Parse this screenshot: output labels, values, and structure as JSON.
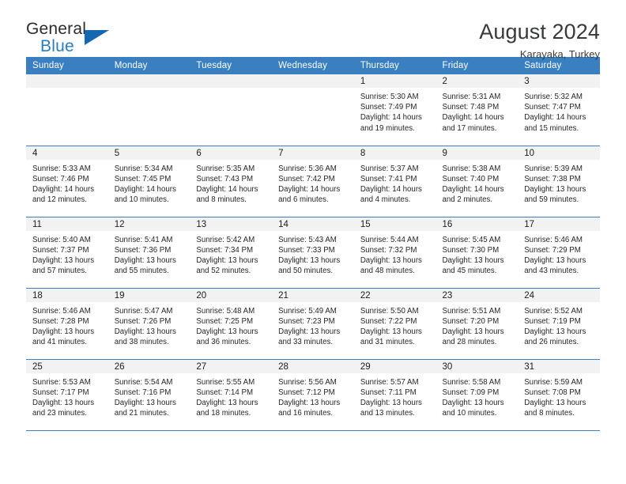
{
  "brand": {
    "name_part1": "General",
    "name_part2": "Blue",
    "triangle_icon": "triangle-icon",
    "color_dark": "#2b2b2b",
    "color_blue": "#2b7cc0"
  },
  "header": {
    "title": "August 2024",
    "subtitle": "Karayaka, Turkey",
    "accent_color": "#3a7fbf",
    "band_color": "#f2f2f2"
  },
  "weekday_headers": [
    "Sunday",
    "Monday",
    "Tuesday",
    "Wednesday",
    "Thursday",
    "Friday",
    "Saturday"
  ],
  "labels": {
    "sunrise": "Sunrise:",
    "sunset": "Sunset:",
    "daylight": "Daylight:"
  },
  "weeks": [
    [
      {
        "day": "",
        "empty": true
      },
      {
        "day": "",
        "empty": true
      },
      {
        "day": "",
        "empty": true
      },
      {
        "day": "",
        "empty": true
      },
      {
        "day": "1",
        "sunrise": "Sunrise: 5:30 AM",
        "sunset": "Sunset: 7:49 PM",
        "daylight_l1": "Daylight: 14 hours",
        "daylight_l2": "and 19 minutes."
      },
      {
        "day": "2",
        "sunrise": "Sunrise: 5:31 AM",
        "sunset": "Sunset: 7:48 PM",
        "daylight_l1": "Daylight: 14 hours",
        "daylight_l2": "and 17 minutes."
      },
      {
        "day": "3",
        "sunrise": "Sunrise: 5:32 AM",
        "sunset": "Sunset: 7:47 PM",
        "daylight_l1": "Daylight: 14 hours",
        "daylight_l2": "and 15 minutes."
      }
    ],
    [
      {
        "day": "4",
        "sunrise": "Sunrise: 5:33 AM",
        "sunset": "Sunset: 7:46 PM",
        "daylight_l1": "Daylight: 14 hours",
        "daylight_l2": "and 12 minutes."
      },
      {
        "day": "5",
        "sunrise": "Sunrise: 5:34 AM",
        "sunset": "Sunset: 7:45 PM",
        "daylight_l1": "Daylight: 14 hours",
        "daylight_l2": "and 10 minutes."
      },
      {
        "day": "6",
        "sunrise": "Sunrise: 5:35 AM",
        "sunset": "Sunset: 7:43 PM",
        "daylight_l1": "Daylight: 14 hours",
        "daylight_l2": "and 8 minutes."
      },
      {
        "day": "7",
        "sunrise": "Sunrise: 5:36 AM",
        "sunset": "Sunset: 7:42 PM",
        "daylight_l1": "Daylight: 14 hours",
        "daylight_l2": "and 6 minutes."
      },
      {
        "day": "8",
        "sunrise": "Sunrise: 5:37 AM",
        "sunset": "Sunset: 7:41 PM",
        "daylight_l1": "Daylight: 14 hours",
        "daylight_l2": "and 4 minutes."
      },
      {
        "day": "9",
        "sunrise": "Sunrise: 5:38 AM",
        "sunset": "Sunset: 7:40 PM",
        "daylight_l1": "Daylight: 14 hours",
        "daylight_l2": "and 2 minutes."
      },
      {
        "day": "10",
        "sunrise": "Sunrise: 5:39 AM",
        "sunset": "Sunset: 7:38 PM",
        "daylight_l1": "Daylight: 13 hours",
        "daylight_l2": "and 59 minutes."
      }
    ],
    [
      {
        "day": "11",
        "sunrise": "Sunrise: 5:40 AM",
        "sunset": "Sunset: 7:37 PM",
        "daylight_l1": "Daylight: 13 hours",
        "daylight_l2": "and 57 minutes."
      },
      {
        "day": "12",
        "sunrise": "Sunrise: 5:41 AM",
        "sunset": "Sunset: 7:36 PM",
        "daylight_l1": "Daylight: 13 hours",
        "daylight_l2": "and 55 minutes."
      },
      {
        "day": "13",
        "sunrise": "Sunrise: 5:42 AM",
        "sunset": "Sunset: 7:34 PM",
        "daylight_l1": "Daylight: 13 hours",
        "daylight_l2": "and 52 minutes."
      },
      {
        "day": "14",
        "sunrise": "Sunrise: 5:43 AM",
        "sunset": "Sunset: 7:33 PM",
        "daylight_l1": "Daylight: 13 hours",
        "daylight_l2": "and 50 minutes."
      },
      {
        "day": "15",
        "sunrise": "Sunrise: 5:44 AM",
        "sunset": "Sunset: 7:32 PM",
        "daylight_l1": "Daylight: 13 hours",
        "daylight_l2": "and 48 minutes."
      },
      {
        "day": "16",
        "sunrise": "Sunrise: 5:45 AM",
        "sunset": "Sunset: 7:30 PM",
        "daylight_l1": "Daylight: 13 hours",
        "daylight_l2": "and 45 minutes."
      },
      {
        "day": "17",
        "sunrise": "Sunrise: 5:46 AM",
        "sunset": "Sunset: 7:29 PM",
        "daylight_l1": "Daylight: 13 hours",
        "daylight_l2": "and 43 minutes."
      }
    ],
    [
      {
        "day": "18",
        "sunrise": "Sunrise: 5:46 AM",
        "sunset": "Sunset: 7:28 PM",
        "daylight_l1": "Daylight: 13 hours",
        "daylight_l2": "and 41 minutes."
      },
      {
        "day": "19",
        "sunrise": "Sunrise: 5:47 AM",
        "sunset": "Sunset: 7:26 PM",
        "daylight_l1": "Daylight: 13 hours",
        "daylight_l2": "and 38 minutes."
      },
      {
        "day": "20",
        "sunrise": "Sunrise: 5:48 AM",
        "sunset": "Sunset: 7:25 PM",
        "daylight_l1": "Daylight: 13 hours",
        "daylight_l2": "and 36 minutes."
      },
      {
        "day": "21",
        "sunrise": "Sunrise: 5:49 AM",
        "sunset": "Sunset: 7:23 PM",
        "daylight_l1": "Daylight: 13 hours",
        "daylight_l2": "and 33 minutes."
      },
      {
        "day": "22",
        "sunrise": "Sunrise: 5:50 AM",
        "sunset": "Sunset: 7:22 PM",
        "daylight_l1": "Daylight: 13 hours",
        "daylight_l2": "and 31 minutes."
      },
      {
        "day": "23",
        "sunrise": "Sunrise: 5:51 AM",
        "sunset": "Sunset: 7:20 PM",
        "daylight_l1": "Daylight: 13 hours",
        "daylight_l2": "and 28 minutes."
      },
      {
        "day": "24",
        "sunrise": "Sunrise: 5:52 AM",
        "sunset": "Sunset: 7:19 PM",
        "daylight_l1": "Daylight: 13 hours",
        "daylight_l2": "and 26 minutes."
      }
    ],
    [
      {
        "day": "25",
        "sunrise": "Sunrise: 5:53 AM",
        "sunset": "Sunset: 7:17 PM",
        "daylight_l1": "Daylight: 13 hours",
        "daylight_l2": "and 23 minutes."
      },
      {
        "day": "26",
        "sunrise": "Sunrise: 5:54 AM",
        "sunset": "Sunset: 7:16 PM",
        "daylight_l1": "Daylight: 13 hours",
        "daylight_l2": "and 21 minutes."
      },
      {
        "day": "27",
        "sunrise": "Sunrise: 5:55 AM",
        "sunset": "Sunset: 7:14 PM",
        "daylight_l1": "Daylight: 13 hours",
        "daylight_l2": "and 18 minutes."
      },
      {
        "day": "28",
        "sunrise": "Sunrise: 5:56 AM",
        "sunset": "Sunset: 7:12 PM",
        "daylight_l1": "Daylight: 13 hours",
        "daylight_l2": "and 16 minutes."
      },
      {
        "day": "29",
        "sunrise": "Sunrise: 5:57 AM",
        "sunset": "Sunset: 7:11 PM",
        "daylight_l1": "Daylight: 13 hours",
        "daylight_l2": "and 13 minutes."
      },
      {
        "day": "30",
        "sunrise": "Sunrise: 5:58 AM",
        "sunset": "Sunset: 7:09 PM",
        "daylight_l1": "Daylight: 13 hours",
        "daylight_l2": "and 10 minutes."
      },
      {
        "day": "31",
        "sunrise": "Sunrise: 5:59 AM",
        "sunset": "Sunset: 7:08 PM",
        "daylight_l1": "Daylight: 13 hours",
        "daylight_l2": "and 8 minutes."
      }
    ]
  ]
}
